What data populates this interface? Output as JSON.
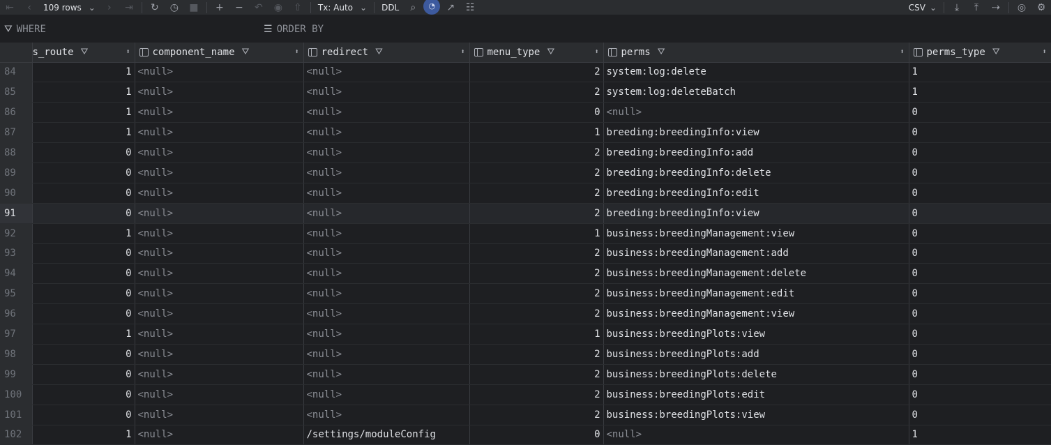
{
  "toolbar": {
    "rows_label": "109 rows",
    "tx_label": "Tx: Auto",
    "ddl_label": "DDL",
    "export_format": "CSV"
  },
  "filter": {
    "where_label": "WHERE",
    "order_label": "ORDER BY"
  },
  "columns": [
    {
      "label": "s_route"
    },
    {
      "label": "component_name"
    },
    {
      "label": "redirect"
    },
    {
      "label": "menu_type"
    },
    {
      "label": "perms"
    },
    {
      "label": "perms_type"
    }
  ],
  "rows": [
    {
      "n": "84",
      "route": "1",
      "component": "<null>",
      "redirect": "<null>",
      "menu_type": "2",
      "perms": "system:log:delete",
      "perms_type": "1"
    },
    {
      "n": "85",
      "route": "1",
      "component": "<null>",
      "redirect": "<null>",
      "menu_type": "2",
      "perms": "system:log:deleteBatch",
      "perms_type": "1"
    },
    {
      "n": "86",
      "route": "1",
      "component": "<null>",
      "redirect": "<null>",
      "menu_type": "0",
      "perms": "<null>",
      "perms_type": "0"
    },
    {
      "n": "87",
      "route": "1",
      "component": "<null>",
      "redirect": "<null>",
      "menu_type": "1",
      "perms": "breeding:breedingInfo:view",
      "perms_type": "0"
    },
    {
      "n": "88",
      "route": "0",
      "component": "<null>",
      "redirect": "<null>",
      "menu_type": "2",
      "perms": "breeding:breedingInfo:add",
      "perms_type": "0"
    },
    {
      "n": "89",
      "route": "0",
      "component": "<null>",
      "redirect": "<null>",
      "menu_type": "2",
      "perms": "breeding:breedingInfo:delete",
      "perms_type": "0"
    },
    {
      "n": "90",
      "route": "0",
      "component": "<null>",
      "redirect": "<null>",
      "menu_type": "2",
      "perms": "breeding:breedingInfo:edit",
      "perms_type": "0"
    },
    {
      "n": "91",
      "route": "0",
      "component": "<null>",
      "redirect": "<null>",
      "menu_type": "2",
      "perms": "breeding:breedingInfo:view",
      "perms_type": "0"
    },
    {
      "n": "92",
      "route": "1",
      "component": "<null>",
      "redirect": "<null>",
      "menu_type": "1",
      "perms": "business:breedingManagement:view",
      "perms_type": "0"
    },
    {
      "n": "93",
      "route": "0",
      "component": "<null>",
      "redirect": "<null>",
      "menu_type": "2",
      "perms": "business:breedingManagement:add",
      "perms_type": "0"
    },
    {
      "n": "94",
      "route": "0",
      "component": "<null>",
      "redirect": "<null>",
      "menu_type": "2",
      "perms": "business:breedingManagement:delete",
      "perms_type": "0"
    },
    {
      "n": "95",
      "route": "0",
      "component": "<null>",
      "redirect": "<null>",
      "menu_type": "2",
      "perms": "business:breedingManagement:edit",
      "perms_type": "0"
    },
    {
      "n": "96",
      "route": "0",
      "component": "<null>",
      "redirect": "<null>",
      "menu_type": "2",
      "perms": "business:breedingManagement:view",
      "perms_type": "0"
    },
    {
      "n": "97",
      "route": "1",
      "component": "<null>",
      "redirect": "<null>",
      "menu_type": "1",
      "perms": "business:breedingPlots:view",
      "perms_type": "0"
    },
    {
      "n": "98",
      "route": "0",
      "component": "<null>",
      "redirect": "<null>",
      "menu_type": "2",
      "perms": "business:breedingPlots:add",
      "perms_type": "0"
    },
    {
      "n": "99",
      "route": "0",
      "component": "<null>",
      "redirect": "<null>",
      "menu_type": "2",
      "perms": "business:breedingPlots:delete",
      "perms_type": "0"
    },
    {
      "n": "100",
      "route": "0",
      "component": "<null>",
      "redirect": "<null>",
      "menu_type": "2",
      "perms": "business:breedingPlots:edit",
      "perms_type": "0"
    },
    {
      "n": "101",
      "route": "0",
      "component": "<null>",
      "redirect": "<null>",
      "menu_type": "2",
      "perms": "business:breedingPlots:view",
      "perms_type": "0"
    },
    {
      "n": "102",
      "route": "1",
      "component": "<null>",
      "redirect": "/settings/moduleConfig",
      "menu_type": "0",
      "perms": "<null>",
      "perms_type": "1"
    }
  ]
}
